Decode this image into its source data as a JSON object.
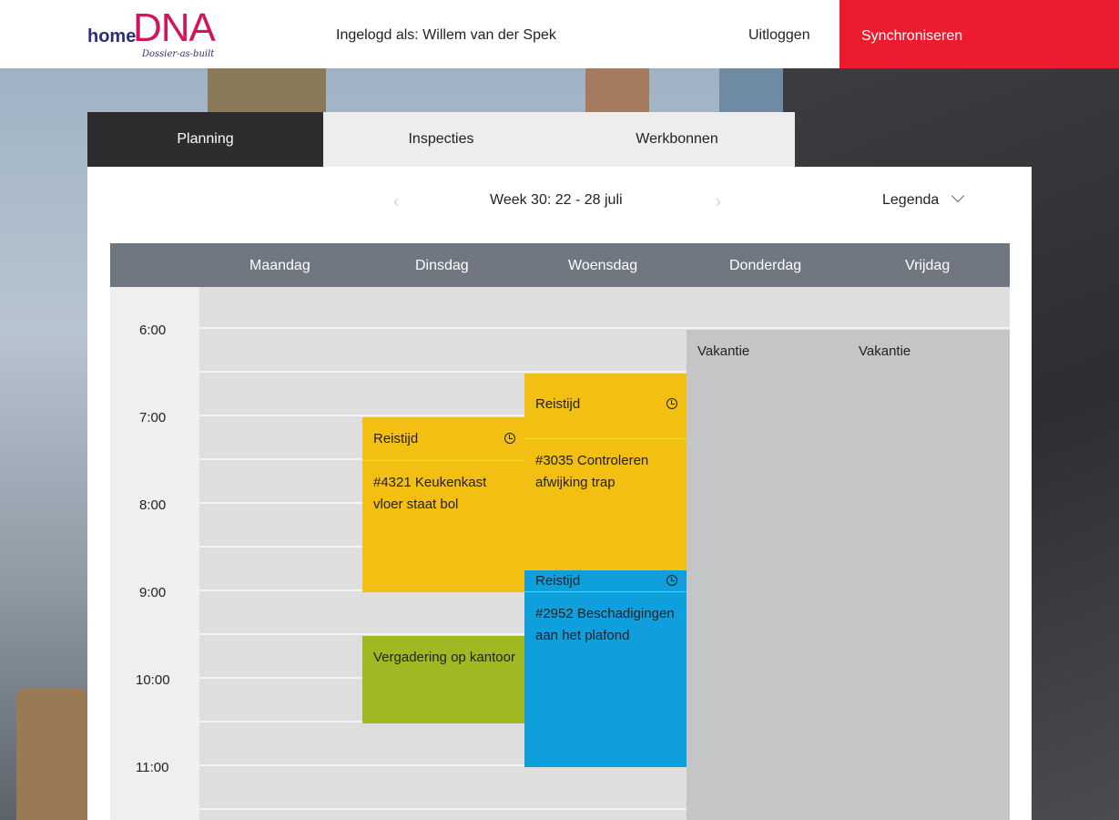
{
  "header": {
    "logo_home": "home",
    "logo_dna": "DNA",
    "logo_tagline": "Dossier-as-built",
    "user_label": "Ingelogd als: Willem van der Spek",
    "logout_label": "Uitloggen",
    "sync_label": "Synchroniseren"
  },
  "tabs": [
    {
      "label": "Planning",
      "active": true
    },
    {
      "label": "Inspecties",
      "active": false
    },
    {
      "label": "Werkbonnen",
      "active": false
    }
  ],
  "week": {
    "title": "Week 30: 22 - 28 juli",
    "prev_icon": "chevron-left-icon",
    "next_icon": "chevron-right-icon",
    "legend_label": "Legenda"
  },
  "days": [
    "Maandag",
    "Dinsdag",
    "Woensdag",
    "Donderdag",
    "Vrijdag"
  ],
  "times": [
    "6:00",
    "7:00",
    "8:00",
    "9:00",
    "10:00",
    "11:00"
  ],
  "events": {
    "tue_travel": "Reistijd",
    "tue_task": "#4321 Keukenkast vloer staat bol",
    "tue_meeting": "Vergadering op kantoor",
    "wed_travel1": "Reistijd",
    "wed_task1": "#3035 Controleren afwijking trap",
    "wed_travel2": "Reistijd",
    "wed_task2": "#2952 Beschadigingen aan het plafond",
    "thu_vacation": "Vakantie",
    "fri_vacation": "Vakantie"
  },
  "colors": {
    "brand_red": "#ec1c2e",
    "logo_magenta": "#d4145a",
    "travel_yellow": "#f3bf12",
    "task_blue": "#0f9fdd",
    "meeting_green": "#a2b823",
    "vacation_grey": "#c4c5c7"
  }
}
